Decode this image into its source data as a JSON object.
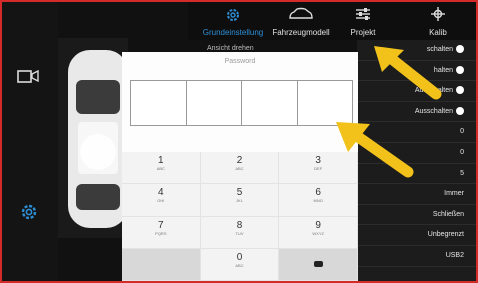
{
  "tabs": [
    {
      "label": "Grundeinstellung",
      "icon": "gear-icon",
      "active": true
    },
    {
      "label": "Fahrzeugmodell",
      "icon": "car-outline-icon",
      "active": false
    },
    {
      "label": "Projekt",
      "icon": "sliders-icon",
      "active": false
    },
    {
      "label": "Kalib",
      "icon": "crosshair-icon",
      "active": false
    }
  ],
  "behind_label": "Ansicht drehen",
  "settings_rows": [
    {
      "text": "schalten",
      "toggle": true
    },
    {
      "text": "halten",
      "toggle": true
    },
    {
      "text": "Ausschalten",
      "toggle": true
    },
    {
      "text": "Ausschalten",
      "toggle": true
    },
    {
      "text": "0",
      "toggle": false
    },
    {
      "text": "0",
      "toggle": false
    },
    {
      "text": "5",
      "toggle": false
    },
    {
      "text": "Immer",
      "toggle": false
    },
    {
      "text": "Schließen",
      "toggle": false
    },
    {
      "text": "Unbegrenzt",
      "toggle": false
    },
    {
      "text": "USB2",
      "toggle": false
    }
  ],
  "dialog": {
    "title": "Password",
    "keys": [
      {
        "num": "1",
        "sub": "ABC"
      },
      {
        "num": "2",
        "sub": "ABC"
      },
      {
        "num": "3",
        "sub": "DEF"
      },
      {
        "num": "4",
        "sub": "GHI"
      },
      {
        "num": "5",
        "sub": "JKL"
      },
      {
        "num": "6",
        "sub": "MNO"
      },
      {
        "num": "7",
        "sub": "PQRS"
      },
      {
        "num": "8",
        "sub": "TUV"
      },
      {
        "num": "9",
        "sub": "WXYZ"
      },
      {
        "num": "",
        "sub": ""
      },
      {
        "num": "0",
        "sub": "ABC"
      },
      {
        "num": "",
        "sub": ""
      }
    ]
  },
  "colors": {
    "accent": "#2e8fd6",
    "frame": "#d32a2a",
    "arrow": "#f2c21b"
  }
}
